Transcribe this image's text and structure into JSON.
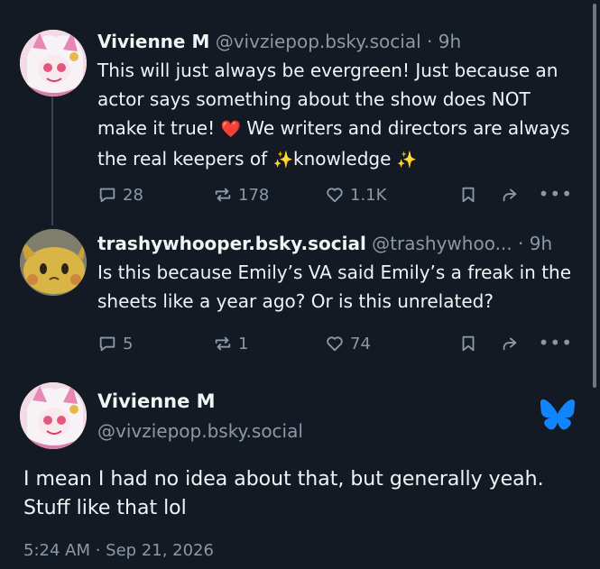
{
  "reply1": {
    "name": "Vivienne M",
    "handle": "@vivziepop.bsky.social",
    "time": "· 9h",
    "text_a": "This will just always be evergreen! Just because an actor says something about the show does NOT make it true! ",
    "emoji_heart": "❤️",
    "text_b": " We writers and directors are always the real keepers of ",
    "emoji_sparkle": "✨",
    "text_c": "knowledge ",
    "emoji_sparkle2": "✨",
    "replies": "28",
    "reposts": "178",
    "likes": "1.1K"
  },
  "reply2": {
    "name": "trashywhooper.bsky.social",
    "handle": "@trashywhoo...",
    "time": "· 9h",
    "text": "Is this because Emily’s VA said Emily’s a freak in the sheets like a year ago? Or is this unrelated?",
    "replies": "5",
    "reposts": "1",
    "likes": "74"
  },
  "main": {
    "name": "Vivienne M",
    "handle": "@vivziepop.bsky.social",
    "text": "I mean I had no idea about that, but generally yeah. Stuff like that lol",
    "timestamp": "5:24 AM · Sep 21, 2026"
  },
  "colors": {
    "background": "#141a23",
    "muted": "#8b98a6",
    "bluesky": "#1185fe"
  },
  "icons": [
    "reply-icon",
    "repost-icon",
    "like-icon",
    "bookmark-icon",
    "share-icon",
    "more-icon",
    "bluesky-butterfly-icon"
  ]
}
